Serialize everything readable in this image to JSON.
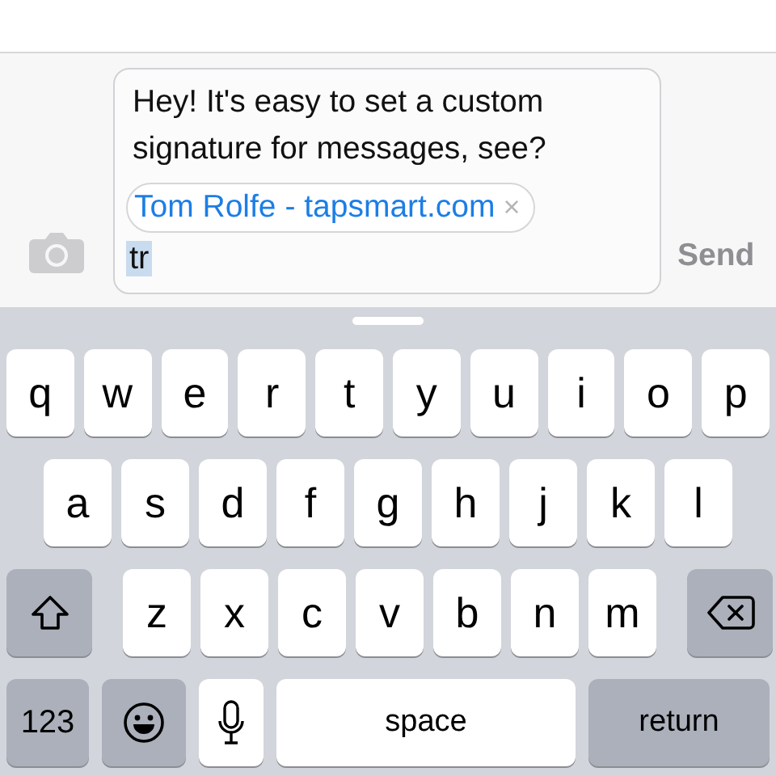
{
  "composer": {
    "message": "Hey! It's easy to set a custom signature for messages, see?",
    "signature": {
      "label": "Tom Rolfe - tapsmart.com",
      "remove": "×"
    },
    "typed": {
      "text": "tr",
      "selected": true
    },
    "send": {
      "label": "Send",
      "disabled": true
    }
  },
  "keyboard": {
    "rows": [
      {
        "keys": [
          {
            "kind": "letter",
            "label": "q"
          },
          {
            "kind": "letter",
            "label": "w"
          },
          {
            "kind": "letter",
            "label": "e"
          },
          {
            "kind": "letter",
            "label": "r"
          },
          {
            "kind": "letter",
            "label": "t"
          },
          {
            "kind": "letter",
            "label": "y"
          },
          {
            "kind": "letter",
            "label": "u"
          },
          {
            "kind": "letter",
            "label": "i"
          },
          {
            "kind": "letter",
            "label": "o"
          },
          {
            "kind": "letter",
            "label": "p"
          }
        ]
      },
      {
        "keys": [
          {
            "kind": "letter",
            "label": "a"
          },
          {
            "kind": "letter",
            "label": "s"
          },
          {
            "kind": "letter",
            "label": "d"
          },
          {
            "kind": "letter",
            "label": "f"
          },
          {
            "kind": "letter",
            "label": "g"
          },
          {
            "kind": "letter",
            "label": "h"
          },
          {
            "kind": "letter",
            "label": "j"
          },
          {
            "kind": "letter",
            "label": "k"
          },
          {
            "kind": "letter",
            "label": "l"
          }
        ]
      },
      {
        "keys": [
          {
            "kind": "shift"
          },
          {
            "kind": "letter",
            "label": "z"
          },
          {
            "kind": "letter",
            "label": "x"
          },
          {
            "kind": "letter",
            "label": "c"
          },
          {
            "kind": "letter",
            "label": "v"
          },
          {
            "kind": "letter",
            "label": "b"
          },
          {
            "kind": "letter",
            "label": "n"
          },
          {
            "kind": "letter",
            "label": "m"
          },
          {
            "kind": "delete"
          }
        ]
      },
      {
        "keys": [
          {
            "kind": "numbers",
            "label": "123"
          },
          {
            "kind": "emoji"
          },
          {
            "kind": "mic"
          },
          {
            "kind": "space",
            "label": "space"
          },
          {
            "kind": "return",
            "label": "return"
          }
        ]
      }
    ]
  }
}
